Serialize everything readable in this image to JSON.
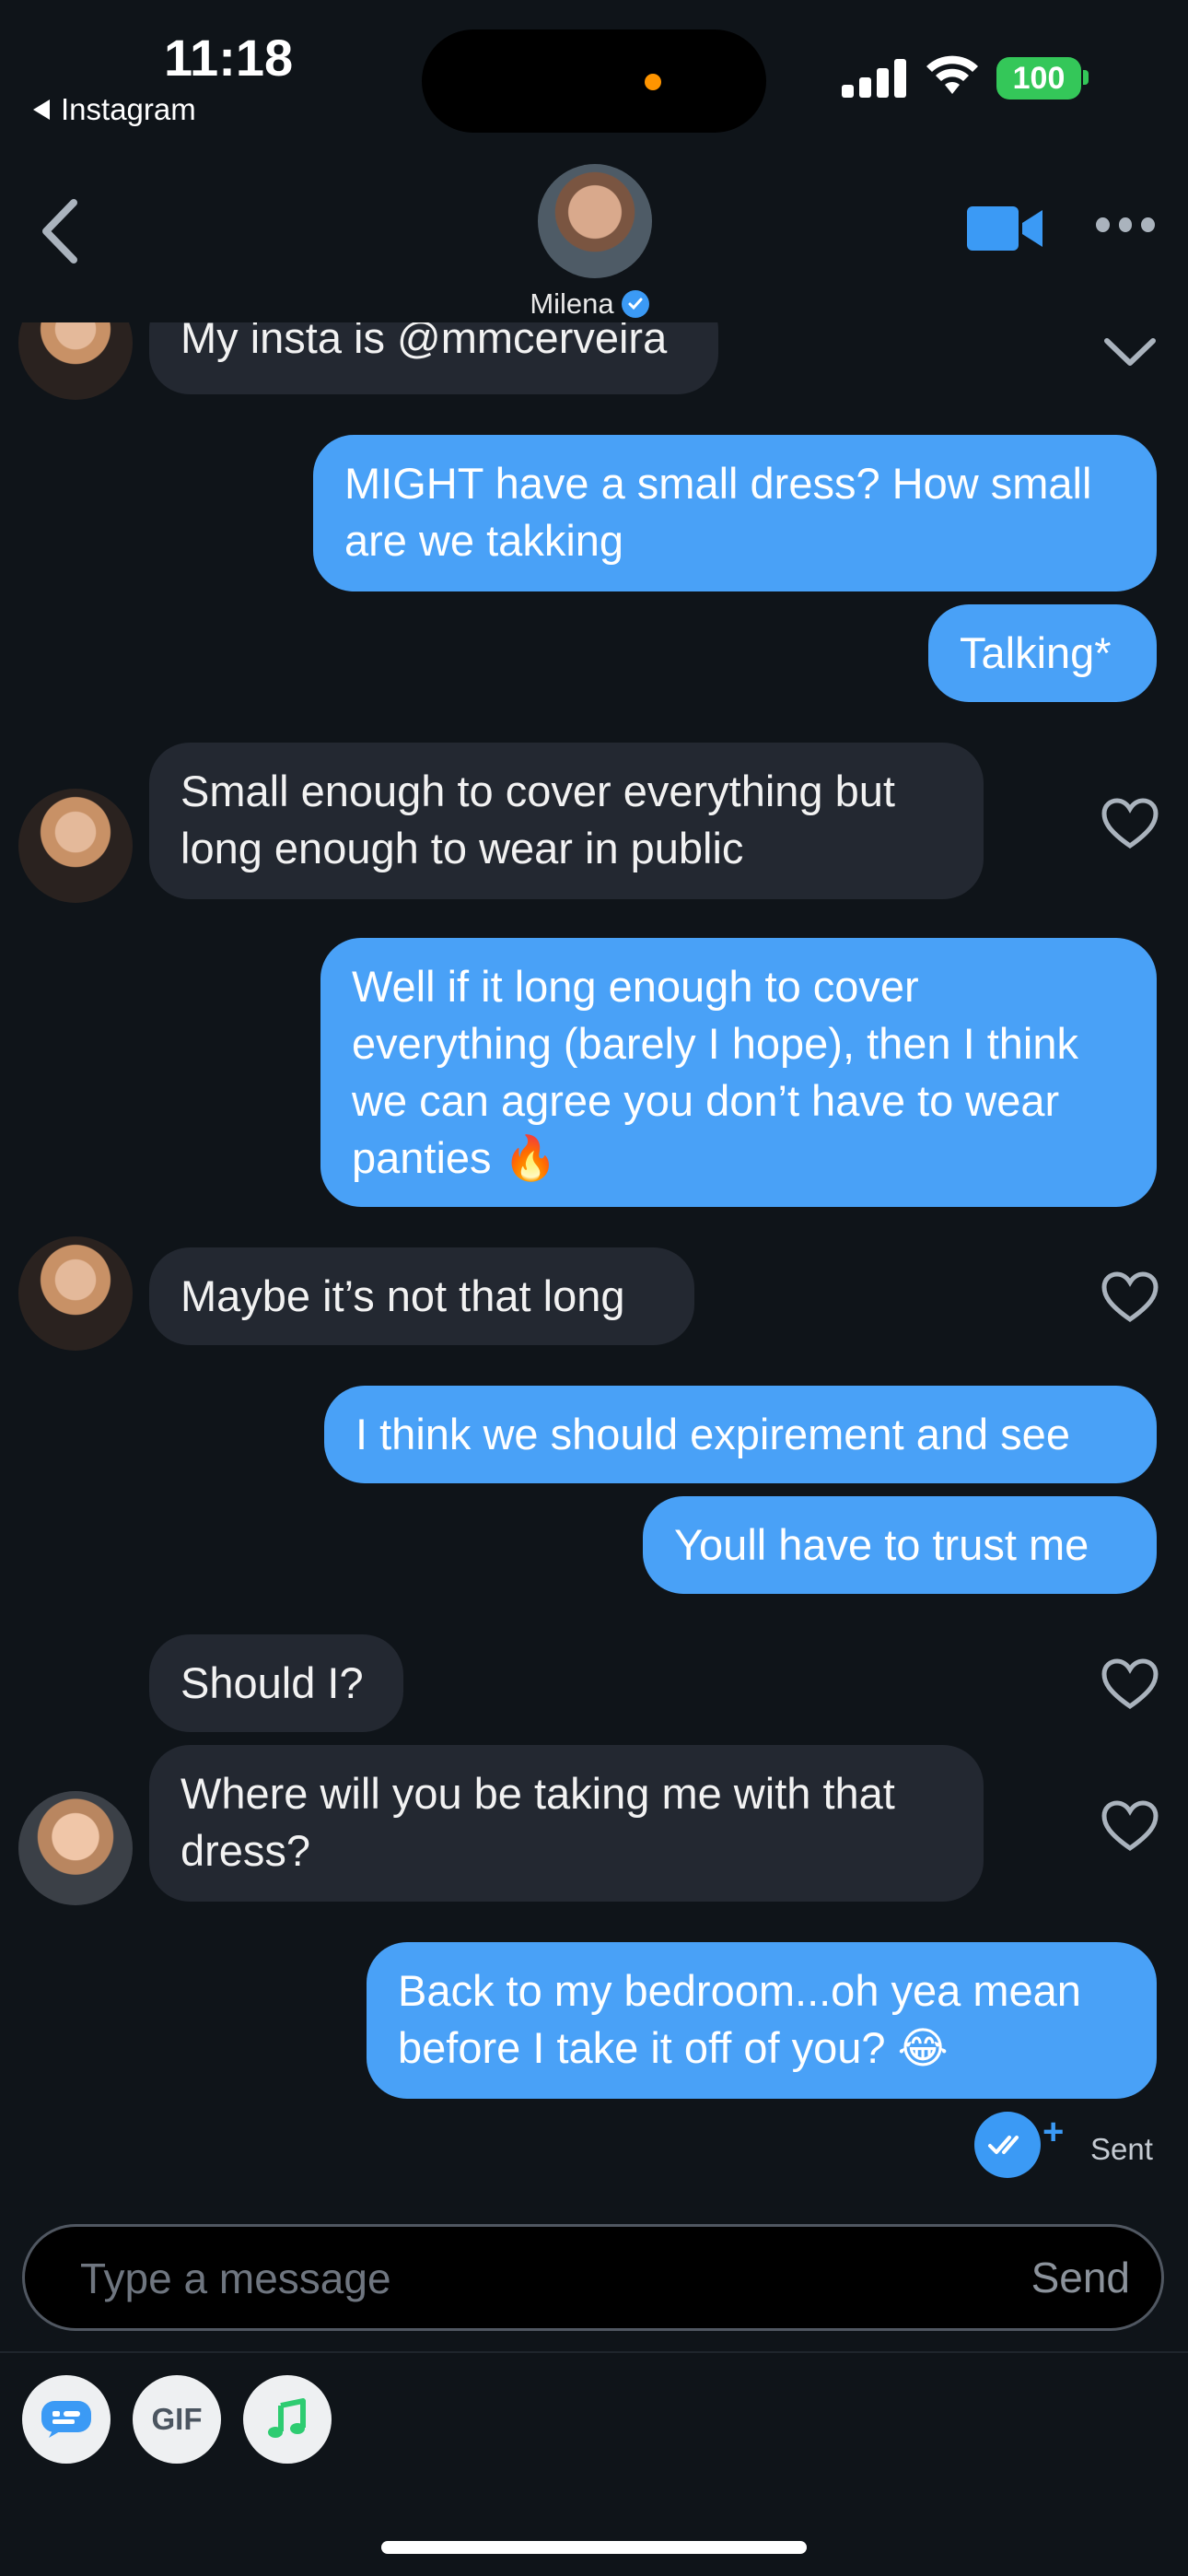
{
  "status_bar": {
    "time": "11:18",
    "back_app": "Instagram",
    "battery": "100"
  },
  "header": {
    "name": "Milena"
  },
  "messages": [
    {
      "text": "My insta is @mmcerveira",
      "side": "in"
    },
    {
      "text": "MIGHT have a small dress? How small are we takking",
      "side": "out"
    },
    {
      "text": "Talking*",
      "side": "out"
    },
    {
      "text": "Small enough to cover everything but long enough to wear in public",
      "side": "in"
    },
    {
      "text": "Well if it long enough to cover everything (barely I hope), then I think we can agree you don’t have to wear panties 🔥",
      "side": "out"
    },
    {
      "text": "Maybe it’s not that long",
      "side": "in"
    },
    {
      "text": "I think we should expirement and see",
      "side": "out"
    },
    {
      "text": "Youll have to trust me",
      "side": "out"
    },
    {
      "text": "Should I?",
      "side": "in"
    },
    {
      "text": "Where will you be taking me with that dress?",
      "side": "in"
    },
    {
      "text": "Back to my bedroom...oh yea mean before I take it off of you? 😂",
      "side": "out"
    }
  ],
  "receipt": {
    "status": "Sent"
  },
  "composer": {
    "placeholder": "Type a message",
    "send_label": "Send"
  },
  "tools": {
    "gif_label": "GIF"
  },
  "colors": {
    "background": "#0f1419",
    "outgoing_bubble": "#49a1f7",
    "incoming_bubble": "#232831",
    "accent": "#3b9af5"
  }
}
